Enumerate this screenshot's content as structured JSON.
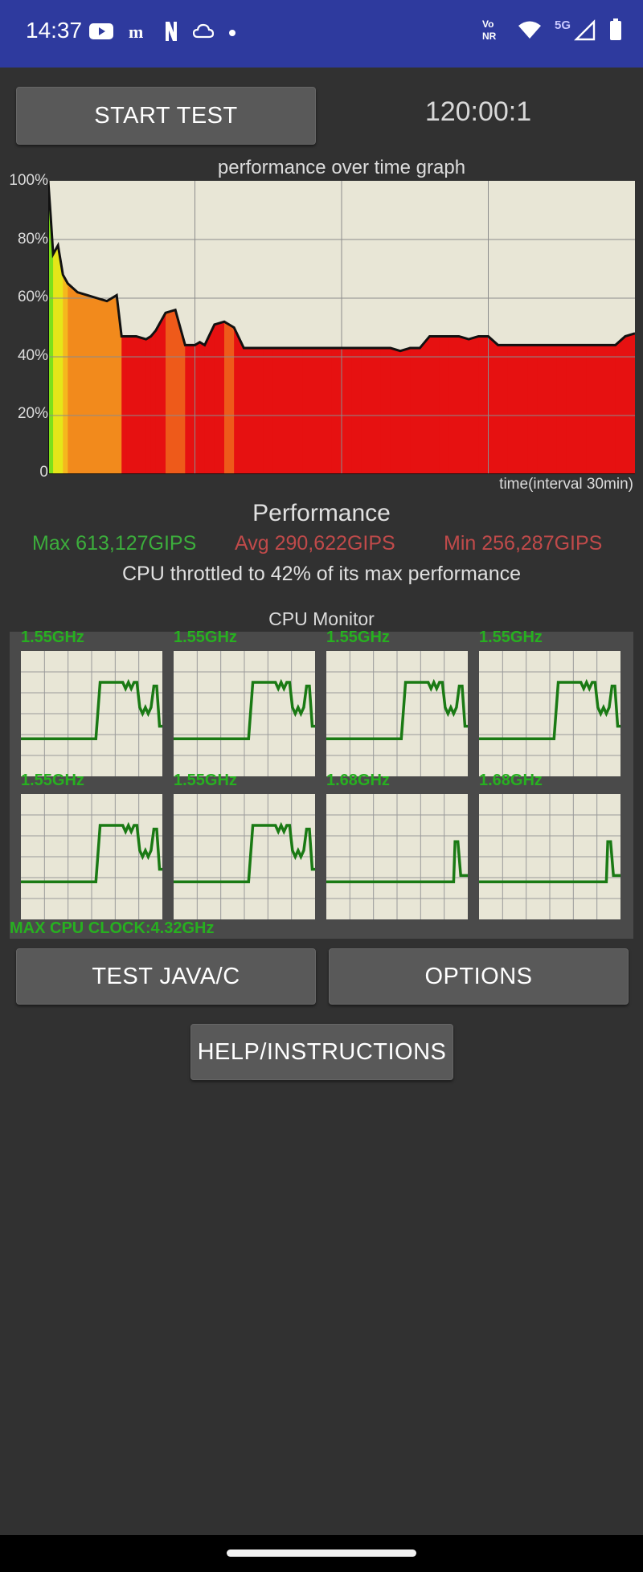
{
  "status_bar": {
    "time": "14:37",
    "left_icons": [
      "youtube-icon",
      "medium-icon",
      "netflix-icon",
      "cloud-icon",
      "dot-icon"
    ],
    "right_icons": [
      "volte-icon",
      "wifi-icon",
      "signal-5g-icon",
      "battery-icon"
    ],
    "network_label": "5G",
    "volte_label": "Vo\nNR"
  },
  "controls": {
    "start_test_label": "START TEST",
    "timer": "120:00:1",
    "test_java_label": "TEST JAVA/C",
    "options_label": "OPTIONS",
    "help_label": "HELP/INSTRUCTIONS"
  },
  "chart_data": {
    "type": "area",
    "title": "performance over time graph",
    "xlabel": "time(interval 30min)",
    "ylabel": "",
    "y_ticks": [
      "100%",
      "80%",
      "60%",
      "40%",
      "20%",
      "0"
    ],
    "ylim": [
      0,
      100
    ],
    "x_interval_minutes": 30,
    "grid": true,
    "series": [
      {
        "x": [
          0,
          0.5,
          1,
          2,
          3,
          4,
          6,
          8,
          10,
          12,
          14,
          15,
          16,
          18,
          20,
          21,
          22,
          24,
          26,
          28,
          30,
          31,
          32,
          34,
          36,
          38,
          40,
          42,
          44,
          46,
          48,
          50,
          52,
          54,
          56,
          58,
          60,
          62,
          64,
          66,
          68,
          70,
          72,
          74,
          76,
          78,
          80,
          82,
          84,
          86,
          88,
          90,
          92,
          94,
          96,
          98,
          100,
          102,
          104,
          106,
          108,
          110,
          112,
          114,
          116,
          118,
          120
        ],
        "values": [
          100,
          88,
          75,
          78,
          68,
          65,
          62,
          61,
          60,
          59,
          61,
          47,
          47,
          47,
          46,
          47,
          49,
          55,
          56,
          44,
          44,
          45,
          44,
          51,
          52,
          50,
          43,
          43,
          43,
          43,
          43,
          43,
          43,
          43,
          43,
          43,
          43,
          43,
          43,
          43,
          43,
          43,
          42,
          43,
          43,
          47,
          47,
          47,
          47,
          46,
          47,
          47,
          44,
          44,
          44,
          44,
          44,
          44,
          44,
          44,
          44,
          44,
          44,
          44,
          44,
          47,
          48
        ]
      }
    ]
  },
  "performance": {
    "heading": "Performance",
    "max": "Max 613,127GIPS",
    "avg": "Avg 290,622GIPS",
    "min": "Min 256,287GIPS",
    "throttle_text": "CPU throttled to 42% of its max performance",
    "max_color": "#3cae3c",
    "avg_color": "#c04a4a",
    "min_color": "#c04a4a"
  },
  "cpu_monitor": {
    "title": "CPU Monitor",
    "max_clock": "MAX CPU CLOCK:4.32GHz",
    "cores": [
      {
        "freq": "1.55GHz",
        "pattern": "A"
      },
      {
        "freq": "1.55GHz",
        "pattern": "A"
      },
      {
        "freq": "1.55GHz",
        "pattern": "A"
      },
      {
        "freq": "1.55GHz",
        "pattern": "A"
      },
      {
        "freq": "1.55GHz",
        "pattern": "A"
      },
      {
        "freq": "1.55GHz",
        "pattern": "A"
      },
      {
        "freq": "1.68GHz",
        "pattern": "B"
      },
      {
        "freq": "1.68GHz",
        "pattern": "B"
      }
    ],
    "line_color": "#1a7a14",
    "label_color": "#27b020"
  }
}
